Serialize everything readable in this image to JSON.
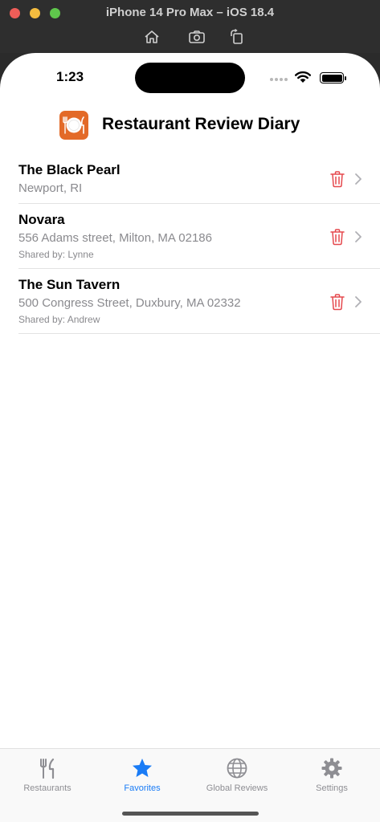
{
  "simulator": {
    "title": "iPhone 14 Pro Max – iOS 18.4",
    "tools": [
      "home-icon",
      "screenshot-icon",
      "rotate-icon"
    ]
  },
  "status_bar": {
    "time": "1:23"
  },
  "header": {
    "title": "Restaurant Review Diary",
    "logo_icon": "plate-cutlery-icon",
    "logo_color": "#e36a28"
  },
  "restaurants": [
    {
      "name": "The Black Pearl",
      "address": "Newport, RI",
      "shared_by": ""
    },
    {
      "name": "Novara",
      "address": "556 Adams street, Milton, MA 02186",
      "shared_by": "Shared by: Lynne"
    },
    {
      "name": "The Sun Tavern",
      "address": "500 Congress Street, Duxbury, MA 02332",
      "shared_by": "Shared by: Andrew"
    }
  ],
  "colors": {
    "accent": "#1a7cf6",
    "delete": "#e5484d",
    "secondary_text": "#8a8a8e"
  },
  "tabbar": {
    "tabs": [
      {
        "label": "Restaurants",
        "icon": "fork-knife-icon",
        "active": false
      },
      {
        "label": "Favorites",
        "icon": "star-icon",
        "active": true
      },
      {
        "label": "Global Reviews",
        "icon": "globe-icon",
        "active": false
      },
      {
        "label": "Settings",
        "icon": "gear-icon",
        "active": false
      }
    ]
  }
}
